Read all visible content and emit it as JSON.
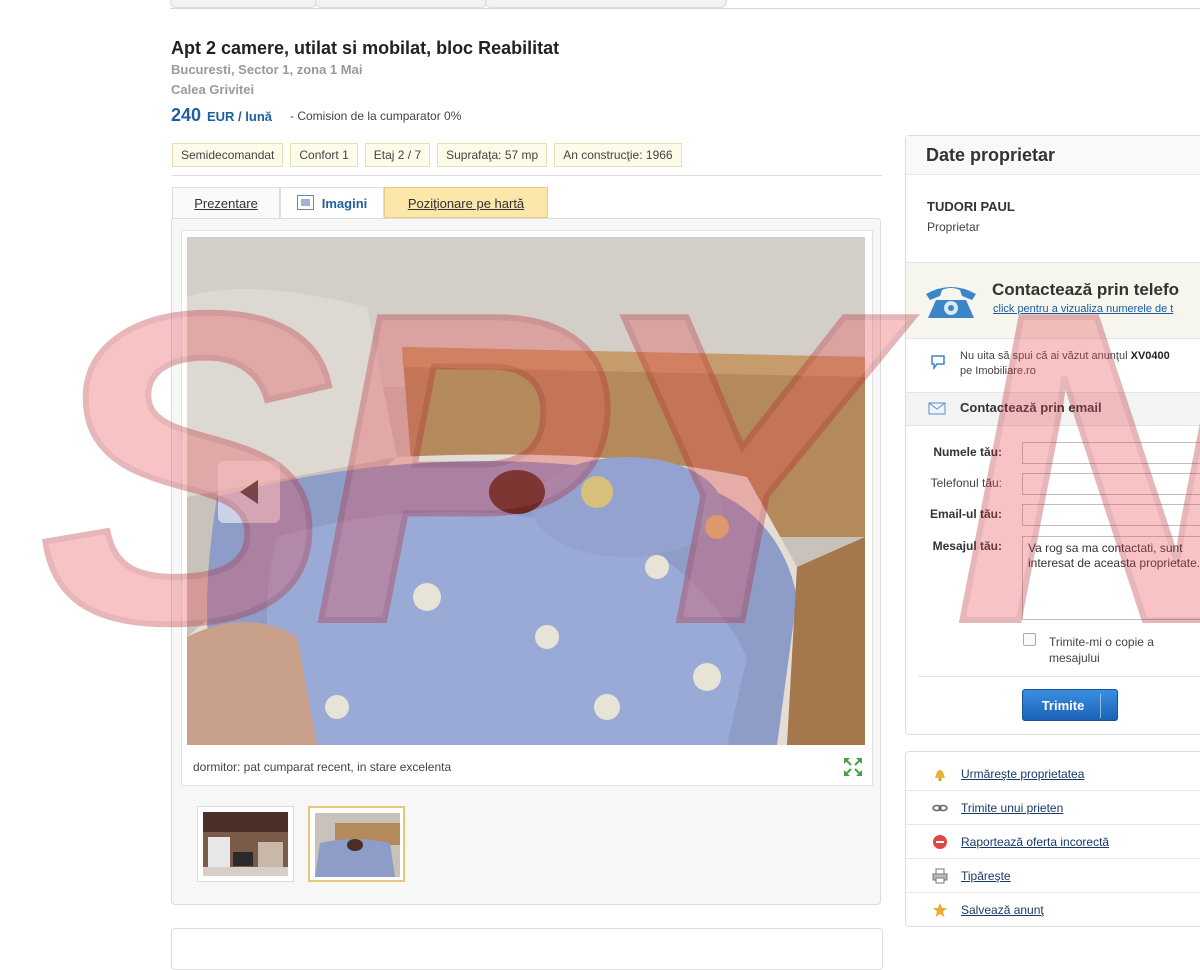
{
  "listing": {
    "title": "Apt 2 camere, utilat si mobilat, bloc Reabilitat",
    "location_line1": "Bucuresti, Sector 1, zona 1 Mai",
    "location_line2": "Calea Grivitei",
    "price_value": "240",
    "price_unit": "EUR / lună",
    "commission": "- Comision de la cumparator 0%"
  },
  "chips": [
    "Semidecomandat",
    "Confort 1",
    "Etaj 2 / 7",
    "Suprafaţa: 57 mp",
    "An construcţie: 1966"
  ],
  "tabs": {
    "presentation": "Prezentare",
    "images": "Imagini",
    "map": "Poziţionare pe hartă"
  },
  "gallery": {
    "caption": "dormitor: pat cumparat recent, in stare excelenta",
    "thumbnails": [
      "kitchen",
      "bedroom"
    ],
    "selected_thumbnail": 2
  },
  "owner": {
    "section_title": "Date proprietar",
    "name": "TUDORI PAUL",
    "role": "Proprietar"
  },
  "contact": {
    "phone_title": "Contactează prin telefo",
    "phone_link": "click pentru a vizualiza numerele de t",
    "reminder_prefix": "Nu uita să spui că ai văzut anunţul",
    "reminder_code": "XV0400",
    "reminder_suffix": "pe Imobiliare.ro",
    "email_title": "Contactează prin email",
    "form": {
      "name_label": "Numele tău:",
      "phone_label": "Telefonul tău:",
      "email_label": "Email-ul tău:",
      "message_label": "Mesajul tău:",
      "message_value": "Va rog sa ma contactati, sunt interesat de aceasta proprietate.",
      "copy_label": "Trimite-mi o copie a mesajului",
      "send_button": "Trimite"
    }
  },
  "actions": [
    {
      "label": "Urmăreşte proprietatea",
      "icon": "bell-icon"
    },
    {
      "label": "Trimite unui prieten",
      "icon": "link-icon"
    },
    {
      "label": "Raportează oferta incorectă",
      "icon": "no-entry-icon"
    },
    {
      "label": "Tipăreşte",
      "icon": "printer-icon"
    },
    {
      "label": "Salvează anunţ",
      "icon": "star-icon"
    }
  ],
  "watermark": "SPY NEWS",
  "colors": {
    "accent": "#1f5f9e",
    "map_tab": "#fbe7a9",
    "watermark": "#e8474f",
    "send_button": "#1a62b8"
  }
}
